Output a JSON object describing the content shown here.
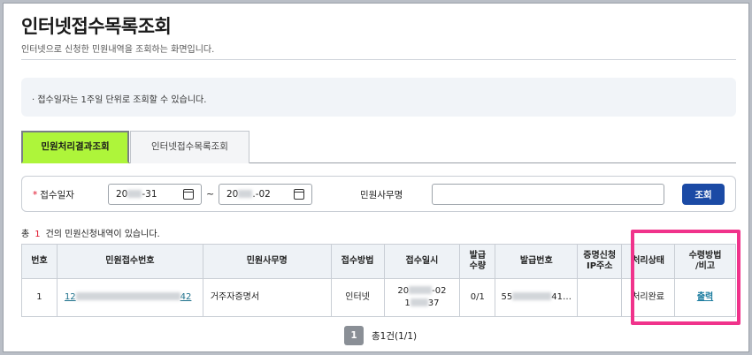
{
  "header": {
    "title": "인터넷접수목록조회",
    "subtitle": "인터넷으로 신청한 민원내역을 조회하는 화면입니다."
  },
  "notice": {
    "text": "· 접수일자는 1주일 단위로 조회할 수 있습니다."
  },
  "tabs": [
    {
      "label": "민원처리결과조회",
      "active": true
    },
    {
      "label": "인터넷접수목록조회",
      "active": false
    }
  ],
  "search": {
    "date_label": "접수일자",
    "required_mark": "*",
    "date_from_prefix": "20",
    "date_from_suffix": "-31",
    "tilde": "~",
    "date_to_prefix": "20",
    "date_to_suffix": ".-02",
    "office_label": "민원사무명",
    "office_value": "",
    "button_label": "조회"
  },
  "summary": {
    "prefix": "총",
    "count": "1",
    "suffix": "건의 민원신청내역이 있습니다."
  },
  "table": {
    "headers": {
      "no": "번호",
      "receipt_no": "민원접수번호",
      "office_name": "민원사무명",
      "method": "접수방법",
      "received_at": "접수일시",
      "issue_qty_1": "발급",
      "issue_qty_2": "수량",
      "issue_no": "발급번호",
      "ip_1": "증명신청",
      "ip_2": "IP주소",
      "status": "처리상태",
      "receive_1": "수령방법",
      "receive_2": "/비고"
    },
    "rows": [
      {
        "no": "1",
        "receipt_no_start": "12",
        "receipt_no_end": "42",
        "office_name": "거주자증명서",
        "method": "인터넷",
        "received_line1_prefix": "20",
        "received_line1_suffix": "-02",
        "received_line2_prefix": "1",
        "received_line2_suffix": "37",
        "issue_qty": "0/1",
        "issue_no_start": "55",
        "issue_no_end": "41…",
        "ip": "",
        "status": "처리완료",
        "action": "출력"
      }
    ]
  },
  "pagination": {
    "current": "1",
    "info": "총1건(1/1)"
  },
  "colors": {
    "active_tab": "#aef53a",
    "search_button": "#1b4aa5",
    "highlight": "#f0338b",
    "required": "#e0122a"
  }
}
